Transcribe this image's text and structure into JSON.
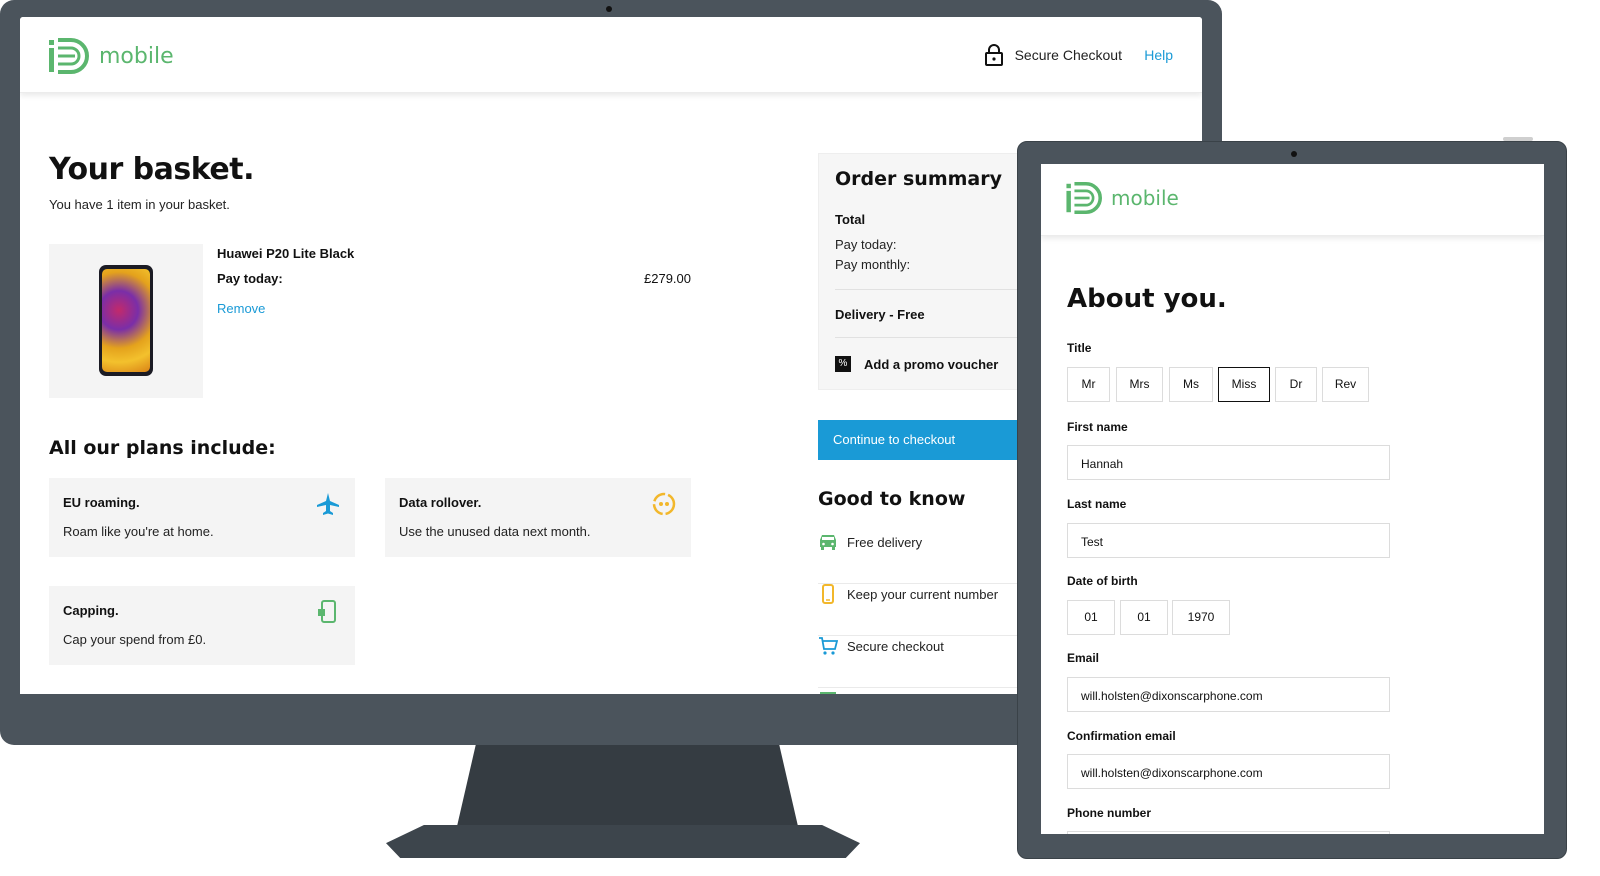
{
  "desktop": {
    "brand": {
      "name": "mobile"
    },
    "header": {
      "secure_label": "Secure Checkout",
      "help_label": "Help"
    },
    "basket": {
      "title": "Your basket.",
      "subtitle": "You have 1 item in your basket.",
      "item": {
        "name": "Huawei P20 Lite Black",
        "pay_today_label": "Pay today:",
        "price": "£279.00",
        "remove_label": "Remove"
      }
    },
    "plans": {
      "title": "All our plans include:",
      "cards": [
        {
          "title": "EU roaming.",
          "desc": "Roam like you're at home.",
          "icon": "plane-icon"
        },
        {
          "title": "Data rollover.",
          "desc": "Use the unused data next month.",
          "icon": "rollover-icon"
        },
        {
          "title": "Capping.",
          "desc": "Cap your spend from £0.",
          "icon": "phone-cap-icon"
        }
      ]
    },
    "summary": {
      "title": "Order summary",
      "total_label": "Total",
      "pay_today_label": "Pay today:",
      "pay_monthly_label": "Pay monthly:",
      "delivery_label": "Delivery - Free",
      "promo_label": "Add a promo voucher",
      "promo_icon_glyph": "%"
    },
    "checkout_button": "Continue to checkout",
    "good_to_know": {
      "title": "Good to know",
      "items": [
        {
          "label": "Free delivery",
          "icon": "van-icon"
        },
        {
          "label": "Keep your current number",
          "icon": "mobile-icon"
        },
        {
          "label": "Secure checkout",
          "icon": "cart-icon"
        }
      ]
    }
  },
  "tablet": {
    "brand": {
      "name": "mobile"
    },
    "form": {
      "title": "About you.",
      "title_label": "Title",
      "title_options": [
        "Mr",
        "Mrs",
        "Ms",
        "Miss",
        "Dr",
        "Rev"
      ],
      "title_selected": "Miss",
      "first_name_label": "First name",
      "first_name_value": "Hannah",
      "last_name_label": "Last name",
      "last_name_value": "Test",
      "dob_label": "Date of birth",
      "dob_day": "01",
      "dob_month": "01",
      "dob_year": "1970",
      "email_label": "Email",
      "email_value": "will.holsten@dixonscarphone.com",
      "confirm_email_label": "Confirmation email",
      "confirm_email_value": "will.holsten@dixonscarphone.com",
      "phone_label": "Phone number"
    }
  },
  "colors": {
    "brand_green": "#5bb66e",
    "accent_blue": "#1a9ad6",
    "device_frame": "#4b545c"
  }
}
